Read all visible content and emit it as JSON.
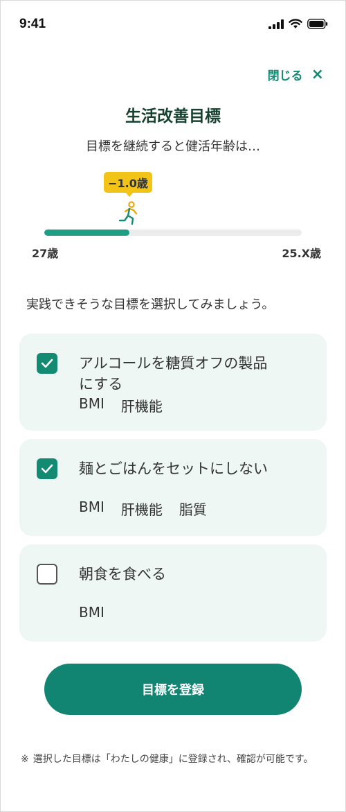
{
  "status": {
    "time": "9:41"
  },
  "header": {
    "close_label": "閉じる",
    "close_icon": "×"
  },
  "title": "生活改善目標",
  "subtitle": "目標を継続すると健活年齢は…",
  "progress": {
    "badge": "−1.0歳",
    "start_label": "27歳",
    "end_label": "25.X歳",
    "fraction": 0.33
  },
  "prompt": "実践できそうな目標を選択してみましょう。",
  "goals": [
    {
      "line1": "アルコールを糖質オフの製品",
      "line2": "にする",
      "tags": [
        "BMI",
        "肝機能"
      ],
      "checked": true
    },
    {
      "line1": "麺とごはんをセットにしない",
      "tags": [
        "BMI",
        "肝機能",
        "脂質"
      ],
      "checked": true
    },
    {
      "line1": "朝食を食べる",
      "tags": [
        "BMI"
      ],
      "checked": false
    }
  ],
  "register_label": "目標を登録",
  "note": {
    "mark": "※",
    "text": "選択した目標は「わたしの健康」に登録され、確認が可能です。"
  },
  "colors": {
    "accent": "#138a72",
    "badge": "#f2c417",
    "card_bg": "#eef7f4",
    "title": "#16402f"
  }
}
